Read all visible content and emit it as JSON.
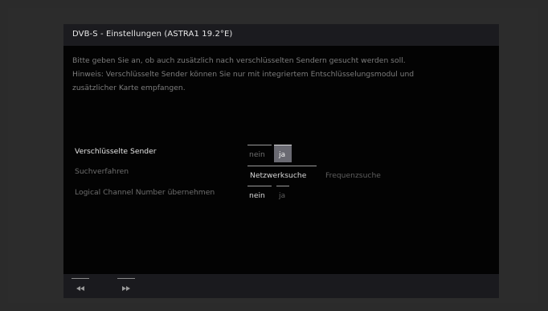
{
  "header": {
    "title": "DVB-S - Einstellungen (ASTRA1 19.2°E)"
  },
  "description": {
    "line1": "Bitte geben Sie an, ob auch zusätzlich nach verschlüsselten Sendern gesucht werden soll.",
    "line2": "Hinweis: Verschlüsselte Sender können Sie nur mit integriertem Entschlüsselungsmodul und",
    "line3": "zusätzlicher Karte empfangen."
  },
  "settings": [
    {
      "label": "Verschlüsselte Sender",
      "options": [
        "nein",
        "ja"
      ],
      "selected": "ja"
    },
    {
      "label": "Suchverfahren",
      "options": [
        "Netzwerksuche",
        "Frequenzsuche"
      ],
      "selected": "Netzwerksuche"
    },
    {
      "label": "Logical Channel Number übernehmen",
      "options": [
        "nein",
        "ja"
      ],
      "selected": "nein"
    }
  ],
  "footer": {
    "icons": [
      "rewind-icon",
      "fast-forward-icon"
    ]
  },
  "colors": {
    "label_active": "#e6e6e6",
    "label_inactive": "#6e6e6e",
    "selected_box": "#6a6a72"
  }
}
